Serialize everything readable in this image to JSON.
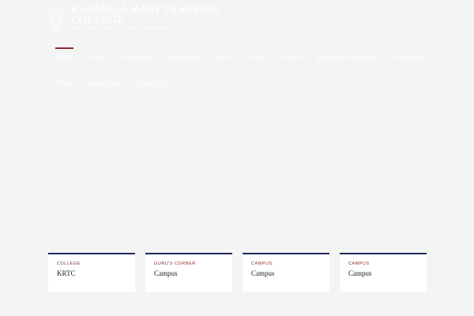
{
  "brand": {
    "title": "Karmela Rani Training College",
    "tagline": "For Teachers of the University",
    "logo_icon": "crest-icon"
  },
  "nav": {
    "items": [
      {
        "label": "Home",
        "active": true
      },
      {
        "label": "About"
      },
      {
        "label": "Academics"
      },
      {
        "label": "Admissions"
      },
      {
        "label": "News"
      },
      {
        "label": "Events"
      },
      {
        "label": "Gallery"
      },
      {
        "label": "Mandatory Disclosure"
      },
      {
        "label": "Downloads"
      },
      {
        "label": "NAAC"
      },
      {
        "label": "Quick Links"
      },
      {
        "label": "Contact Us"
      }
    ]
  },
  "cards": [
    {
      "category": "College",
      "title": "KRTC"
    },
    {
      "category": "Guru's Corner",
      "title": "Campus"
    },
    {
      "category": "Campus",
      "title": "Campus"
    },
    {
      "category": "Campus",
      "title": "Campus"
    }
  ],
  "colors": {
    "background": "#f4f4f4",
    "accent": "#8b2a2a",
    "card_border": "#1e2a5a",
    "card_bg": "#ffffff"
  }
}
